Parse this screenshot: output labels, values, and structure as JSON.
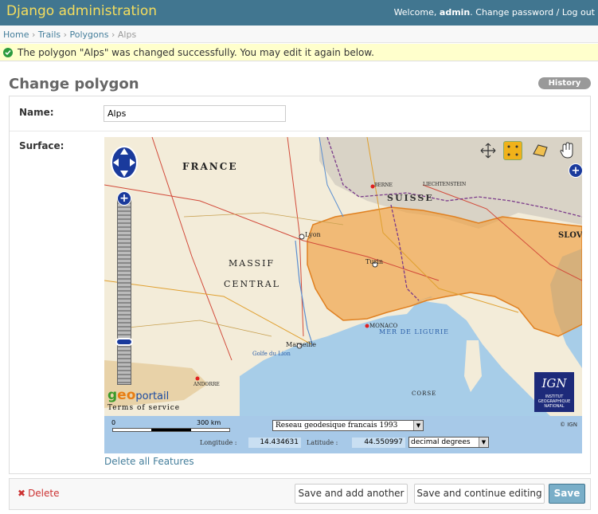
{
  "header": {
    "branding": "Django administration",
    "welcome": "Welcome,",
    "username": "admin",
    "change_password": "Change password",
    "separator": "/",
    "logout": "Log out"
  },
  "breadcrumbs": {
    "home": "Home",
    "app": "Trails",
    "model": "Polygons",
    "current": "Alps",
    "sep": "›"
  },
  "message": "The polygon \"Alps\" was changed successfully. You may edit it again below.",
  "page_title": "Change polygon",
  "history_label": "History",
  "form": {
    "name_label": "Name:",
    "name_value": "Alps",
    "surface_label": "Surface:"
  },
  "map": {
    "labels": {
      "france": "FRANCE",
      "suisse": "SUISSE",
      "massif": "MASSIF",
      "central": "CENTRAL",
      "mer_ligurie": "MER DE LIGURIE",
      "monaco": "MONACO",
      "lyon": "Lyon",
      "marseille": "Marseille",
      "turin": "Turin",
      "corse": "CORSE",
      "berne": "BERNE",
      "liechtenstein": "LIECHTENSTEIN",
      "andorre": "ANDORRE",
      "slov": "SLOV",
      "golfe_lion": "Golfe du Lion"
    },
    "zoom_plus": "+",
    "expand": "+",
    "geoportail": {
      "g": "g",
      "e": "e",
      "o": "o",
      "portail": "portail"
    },
    "terms": "Terms of service",
    "ign_logo": "IGN",
    "ign_sub": "INSTITUT GEOGRAPHIQUE NATIONAL",
    "tools": [
      "pan-icon",
      "draw-point-icon",
      "draw-polygon-icon",
      "drag-hand-icon"
    ],
    "footer": {
      "scale_zero": "0",
      "scale_max": "300 km",
      "crs": "Reseau geodesique francais 1993",
      "ign_copy": "© IGN",
      "longitude_label": "Longitude :",
      "longitude_value": "14.434631",
      "latitude_label": "Latitude :",
      "latitude_value": "44.550997",
      "units": "decimal degrees"
    },
    "delete_all": "Delete all Features"
  },
  "submit": {
    "delete": "Delete",
    "save_add_another": "Save and add another",
    "save_continue": "Save and continue editing",
    "save": "Save"
  },
  "colors": {
    "header": "#417690",
    "branding": "#f5dd5d",
    "link": "#447e9b",
    "polygon_fill": "#f0a040",
    "map_sea": "#a7cde8",
    "save_button": "#79aec8"
  }
}
